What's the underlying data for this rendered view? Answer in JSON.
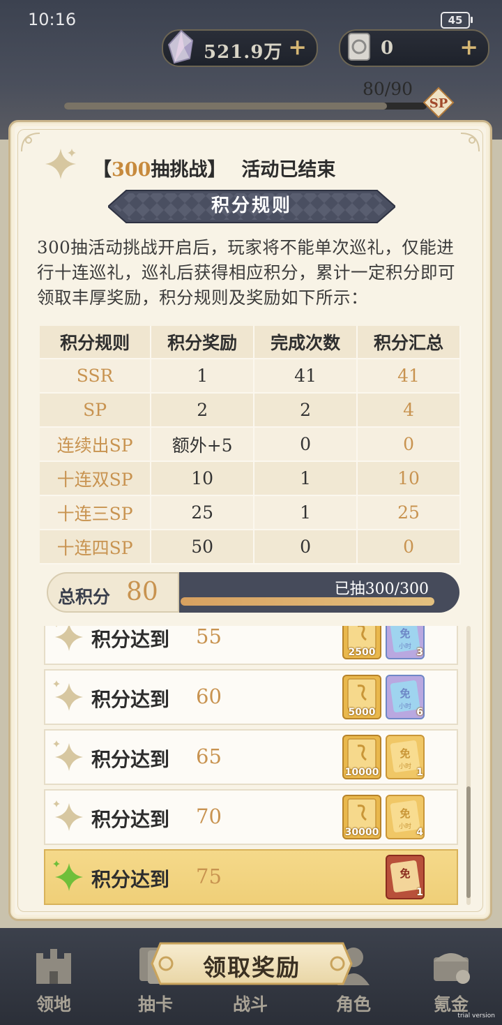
{
  "status_bar": {
    "time": "10:16",
    "battery": "45"
  },
  "currencies": [
    {
      "icon": "crystal-icon",
      "value": "521.9万",
      "plus": "+"
    },
    {
      "icon": "scroll-ticket-icon",
      "value": "0",
      "plus": "+"
    }
  ],
  "top_progress": {
    "label": "80/90",
    "fraction": 0.89
  },
  "modal": {
    "title_prefix": "【",
    "title_accent": "300",
    "title_main": "抽挑战】",
    "title_status": "活动已结束",
    "banner": "积分规则",
    "description": "300抽活动挑战开启后，玩家将不能单次巡礼，仅能进行十连巡礼，巡礼后获得相应积分，累计一定积分即可领取丰厚奖励，积分规则及奖励如下所示：",
    "table": {
      "headers": [
        "积分规则",
        "积分奖励",
        "完成次数",
        "积分汇总"
      ],
      "rows": [
        [
          "SSR",
          "1",
          "41",
          "41"
        ],
        [
          "SP",
          "2",
          "2",
          "4"
        ],
        [
          "连续出SP",
          "额外+5",
          "0",
          "0"
        ],
        [
          "十连双SP",
          "10",
          "1",
          "10"
        ],
        [
          "十连三SP",
          "25",
          "1",
          "25"
        ],
        [
          "十连四SP",
          "50",
          "0",
          "0"
        ]
      ]
    },
    "total": {
      "label": "总积分",
      "value": "80",
      "drawn_label": "已抽300/300",
      "drawn_fraction": 1.0
    },
    "rewards": [
      {
        "label": "积分达到",
        "value": "55",
        "ticket1": "2500",
        "ticket2": "3",
        "ticket2_type": "blue",
        "active": false
      },
      {
        "label": "积分达到",
        "value": "60",
        "ticket1": "5000",
        "ticket2": "6",
        "ticket2_type": "blue",
        "active": false
      },
      {
        "label": "积分达到",
        "value": "65",
        "ticket1": "10000",
        "ticket2": "1",
        "ticket2_type": "gold",
        "active": false
      },
      {
        "label": "积分达到",
        "value": "70",
        "ticket1": "30000",
        "ticket2": "4",
        "ticket2_type": "gold",
        "active": false
      },
      {
        "label": "积分达到",
        "value": "75",
        "ticket1": "",
        "ticket2": "1",
        "ticket2_type": "red",
        "active": true
      }
    ],
    "ticket_glyphs": {
      "free": "免",
      "small": "小时"
    },
    "claim_button": "领取奖励"
  },
  "bottom_nav": [
    {
      "label": "领地",
      "icon": "castle-icon"
    },
    {
      "label": "抽卡",
      "icon": "card-icon"
    },
    {
      "label": "战斗",
      "icon": "swords-icon"
    },
    {
      "label": "角色",
      "icon": "character-icon"
    },
    {
      "label": "氪金",
      "icon": "treasure-chest-icon"
    }
  ],
  "watermark": "trial version",
  "colors": {
    "accent": "#c89350",
    "panel": "#f8f3e6",
    "dark": "#464b5b",
    "active_row": "#f2d47f"
  }
}
